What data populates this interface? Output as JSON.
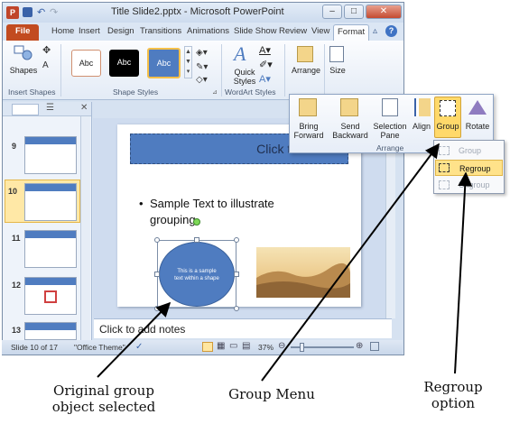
{
  "window": {
    "title": "Title Slide2.pptx - Microsoft PowerPoint",
    "controls": [
      "–",
      "□",
      "✕"
    ]
  },
  "ribbon_tabs": [
    "File",
    "Home",
    "Insert",
    "Design",
    "Transitions",
    "Animations",
    "Slide Show",
    "Review",
    "View",
    "Format"
  ],
  "ribbon": {
    "shapes_label": "Shapes",
    "insert_shapes_group": "Insert Shapes",
    "styles": [
      "Abc",
      "Abc",
      "Abc"
    ],
    "shape_styles_group": "Shape Styles",
    "quick_styles_label": "Quick Styles",
    "wordart_group": "WordArt Styles",
    "arrange_label": "Arrange",
    "size_label": "Size"
  },
  "arrange_popup": {
    "buttons": [
      {
        "line1": "Bring",
        "line2": "Forward"
      },
      {
        "line1": "Send",
        "line2": "Backward"
      },
      {
        "line1": "Selection",
        "line2": "Pane"
      },
      {
        "line1": "Align",
        "line2": ""
      },
      {
        "line1": "Group",
        "line2": ""
      },
      {
        "line1": "Rotate",
        "line2": ""
      }
    ],
    "group_label": "Arrange"
  },
  "group_menu": {
    "items": [
      "Group",
      "Regroup",
      "Ungroup"
    ]
  },
  "thumbnails": [
    "9",
    "10",
    "11",
    "12",
    "13"
  ],
  "slide": {
    "title_placeholder": "Click to add title",
    "bullet": "•",
    "body_line1": "Sample Text to illustrate",
    "body_line2": "grouping",
    "ellipse_text_1": "This is a sample",
    "ellipse_text_2": "text within a shape"
  },
  "notes_placeholder": "Click to add notes",
  "status_bar": {
    "slide_info": "Slide 10 of 17",
    "theme": "\"Office Theme\"",
    "zoom": "37%"
  },
  "annotations": {
    "left_line1": "Original group",
    "left_line2": "object selected",
    "middle": "Group Menu",
    "right_line1": "Regroup",
    "right_line2": "option"
  },
  "colors": {
    "accent_blue": "#4f7cc0",
    "file_tab": "#c24b20",
    "highlight": "#ffd96a"
  }
}
